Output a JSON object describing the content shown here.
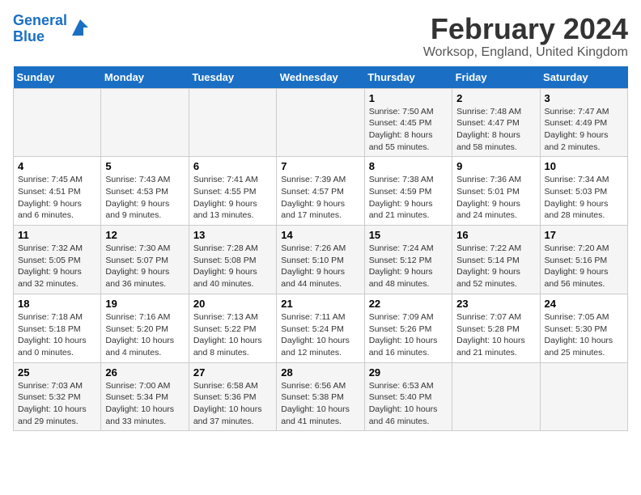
{
  "logo": {
    "text1": "General",
    "text2": "Blue"
  },
  "title": "February 2024",
  "subtitle": "Worksop, England, United Kingdom",
  "days_of_week": [
    "Sunday",
    "Monday",
    "Tuesday",
    "Wednesday",
    "Thursday",
    "Friday",
    "Saturday"
  ],
  "weeks": [
    [
      {
        "day": "",
        "info": ""
      },
      {
        "day": "",
        "info": ""
      },
      {
        "day": "",
        "info": ""
      },
      {
        "day": "",
        "info": ""
      },
      {
        "day": "1",
        "info": "Sunrise: 7:50 AM\nSunset: 4:45 PM\nDaylight: 8 hours and 55 minutes."
      },
      {
        "day": "2",
        "info": "Sunrise: 7:48 AM\nSunset: 4:47 PM\nDaylight: 8 hours and 58 minutes."
      },
      {
        "day": "3",
        "info": "Sunrise: 7:47 AM\nSunset: 4:49 PM\nDaylight: 9 hours and 2 minutes."
      }
    ],
    [
      {
        "day": "4",
        "info": "Sunrise: 7:45 AM\nSunset: 4:51 PM\nDaylight: 9 hours and 6 minutes."
      },
      {
        "day": "5",
        "info": "Sunrise: 7:43 AM\nSunset: 4:53 PM\nDaylight: 9 hours and 9 minutes."
      },
      {
        "day": "6",
        "info": "Sunrise: 7:41 AM\nSunset: 4:55 PM\nDaylight: 9 hours and 13 minutes."
      },
      {
        "day": "7",
        "info": "Sunrise: 7:39 AM\nSunset: 4:57 PM\nDaylight: 9 hours and 17 minutes."
      },
      {
        "day": "8",
        "info": "Sunrise: 7:38 AM\nSunset: 4:59 PM\nDaylight: 9 hours and 21 minutes."
      },
      {
        "day": "9",
        "info": "Sunrise: 7:36 AM\nSunset: 5:01 PM\nDaylight: 9 hours and 24 minutes."
      },
      {
        "day": "10",
        "info": "Sunrise: 7:34 AM\nSunset: 5:03 PM\nDaylight: 9 hours and 28 minutes."
      }
    ],
    [
      {
        "day": "11",
        "info": "Sunrise: 7:32 AM\nSunset: 5:05 PM\nDaylight: 9 hours and 32 minutes."
      },
      {
        "day": "12",
        "info": "Sunrise: 7:30 AM\nSunset: 5:07 PM\nDaylight: 9 hours and 36 minutes."
      },
      {
        "day": "13",
        "info": "Sunrise: 7:28 AM\nSunset: 5:08 PM\nDaylight: 9 hours and 40 minutes."
      },
      {
        "day": "14",
        "info": "Sunrise: 7:26 AM\nSunset: 5:10 PM\nDaylight: 9 hours and 44 minutes."
      },
      {
        "day": "15",
        "info": "Sunrise: 7:24 AM\nSunset: 5:12 PM\nDaylight: 9 hours and 48 minutes."
      },
      {
        "day": "16",
        "info": "Sunrise: 7:22 AM\nSunset: 5:14 PM\nDaylight: 9 hours and 52 minutes."
      },
      {
        "day": "17",
        "info": "Sunrise: 7:20 AM\nSunset: 5:16 PM\nDaylight: 9 hours and 56 minutes."
      }
    ],
    [
      {
        "day": "18",
        "info": "Sunrise: 7:18 AM\nSunset: 5:18 PM\nDaylight: 10 hours and 0 minutes."
      },
      {
        "day": "19",
        "info": "Sunrise: 7:16 AM\nSunset: 5:20 PM\nDaylight: 10 hours and 4 minutes."
      },
      {
        "day": "20",
        "info": "Sunrise: 7:13 AM\nSunset: 5:22 PM\nDaylight: 10 hours and 8 minutes."
      },
      {
        "day": "21",
        "info": "Sunrise: 7:11 AM\nSunset: 5:24 PM\nDaylight: 10 hours and 12 minutes."
      },
      {
        "day": "22",
        "info": "Sunrise: 7:09 AM\nSunset: 5:26 PM\nDaylight: 10 hours and 16 minutes."
      },
      {
        "day": "23",
        "info": "Sunrise: 7:07 AM\nSunset: 5:28 PM\nDaylight: 10 hours and 21 minutes."
      },
      {
        "day": "24",
        "info": "Sunrise: 7:05 AM\nSunset: 5:30 PM\nDaylight: 10 hours and 25 minutes."
      }
    ],
    [
      {
        "day": "25",
        "info": "Sunrise: 7:03 AM\nSunset: 5:32 PM\nDaylight: 10 hours and 29 minutes."
      },
      {
        "day": "26",
        "info": "Sunrise: 7:00 AM\nSunset: 5:34 PM\nDaylight: 10 hours and 33 minutes."
      },
      {
        "day": "27",
        "info": "Sunrise: 6:58 AM\nSunset: 5:36 PM\nDaylight: 10 hours and 37 minutes."
      },
      {
        "day": "28",
        "info": "Sunrise: 6:56 AM\nSunset: 5:38 PM\nDaylight: 10 hours and 41 minutes."
      },
      {
        "day": "29",
        "info": "Sunrise: 6:53 AM\nSunset: 5:40 PM\nDaylight: 10 hours and 46 minutes."
      },
      {
        "day": "",
        "info": ""
      },
      {
        "day": "",
        "info": ""
      }
    ]
  ]
}
